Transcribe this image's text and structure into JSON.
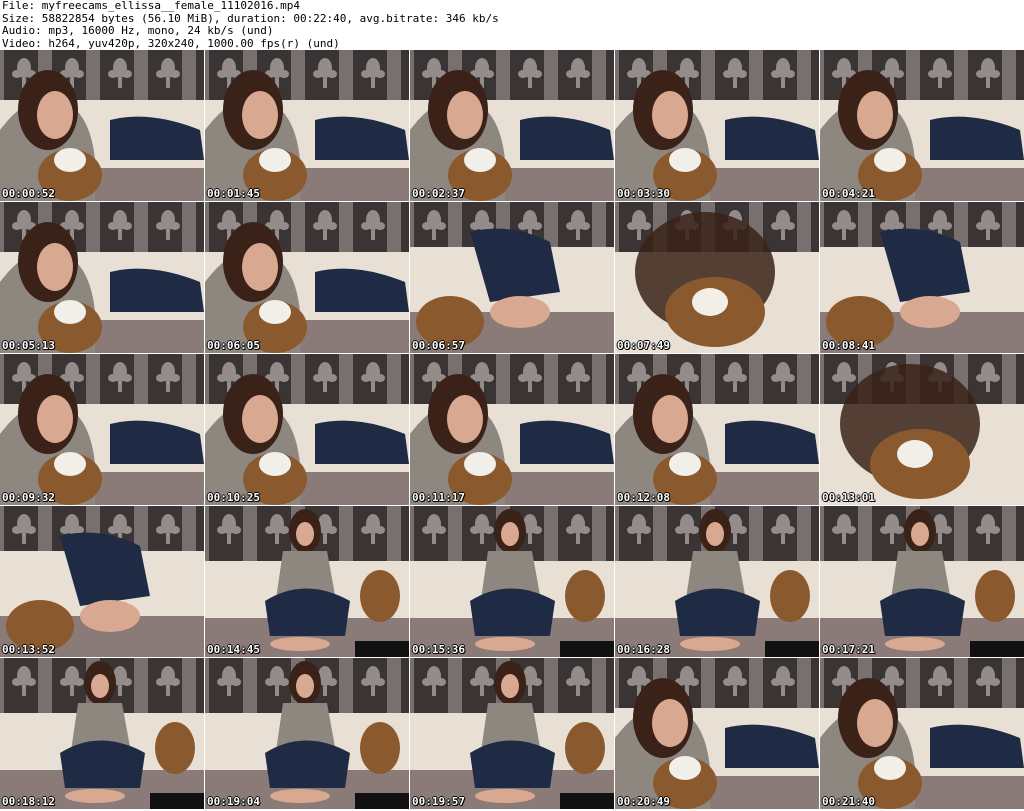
{
  "header": {
    "file": "File: myfreecams_ellissa__female_11102016.mp4",
    "size": "Size: 58822854 bytes (56.10 MiB), duration: 00:22:40, avg.bitrate: 346 kb/s",
    "audio": "Audio: mp3, 16000 Hz, mono, 24 kb/s (und)",
    "video": "Video: h264, yuv420p, 320x240, 1000.00 fps(r) (und)"
  },
  "thumbnails": [
    {
      "time": "00:00:52",
      "scene": "lying-close"
    },
    {
      "time": "00:01:45",
      "scene": "lying-close"
    },
    {
      "time": "00:02:37",
      "scene": "lying-close"
    },
    {
      "time": "00:03:30",
      "scene": "lying-close"
    },
    {
      "time": "00:04:21",
      "scene": "lying-close"
    },
    {
      "time": "00:05:13",
      "scene": "lying-close"
    },
    {
      "time": "00:06:05",
      "scene": "lying-close"
    },
    {
      "time": "00:06:57",
      "scene": "legs"
    },
    {
      "time": "00:07:49",
      "scene": "blur"
    },
    {
      "time": "00:08:41",
      "scene": "legs"
    },
    {
      "time": "00:09:32",
      "scene": "lying-close"
    },
    {
      "time": "00:10:25",
      "scene": "lying-close"
    },
    {
      "time": "00:11:17",
      "scene": "lying-close"
    },
    {
      "time": "00:12:08",
      "scene": "lying-close"
    },
    {
      "time": "00:13:01",
      "scene": "blur"
    },
    {
      "time": "00:13:52",
      "scene": "legs"
    },
    {
      "time": "00:14:45",
      "scene": "sitting"
    },
    {
      "time": "00:15:36",
      "scene": "sitting"
    },
    {
      "time": "00:16:28",
      "scene": "sitting"
    },
    {
      "time": "00:17:21",
      "scene": "sitting"
    },
    {
      "time": "00:18:12",
      "scene": "sitting"
    },
    {
      "time": "00:19:04",
      "scene": "sitting"
    },
    {
      "time": "00:19:57",
      "scene": "sitting"
    },
    {
      "time": "00:20:49",
      "scene": "lying-close"
    },
    {
      "time": "00:21:40",
      "scene": "lying-close"
    }
  ],
  "colors": {
    "wall_dark": "#3b3434",
    "wall_light": "#a9a3a0",
    "sofa": "#e8e0d4",
    "blanket": "#8a7a78",
    "hair": "#3a2218",
    "skin": "#d9a891",
    "sweater": "#8d8780",
    "jeans": "#1f2a44",
    "bear": "#8a5a2e",
    "timestamp": "#ffffff"
  }
}
